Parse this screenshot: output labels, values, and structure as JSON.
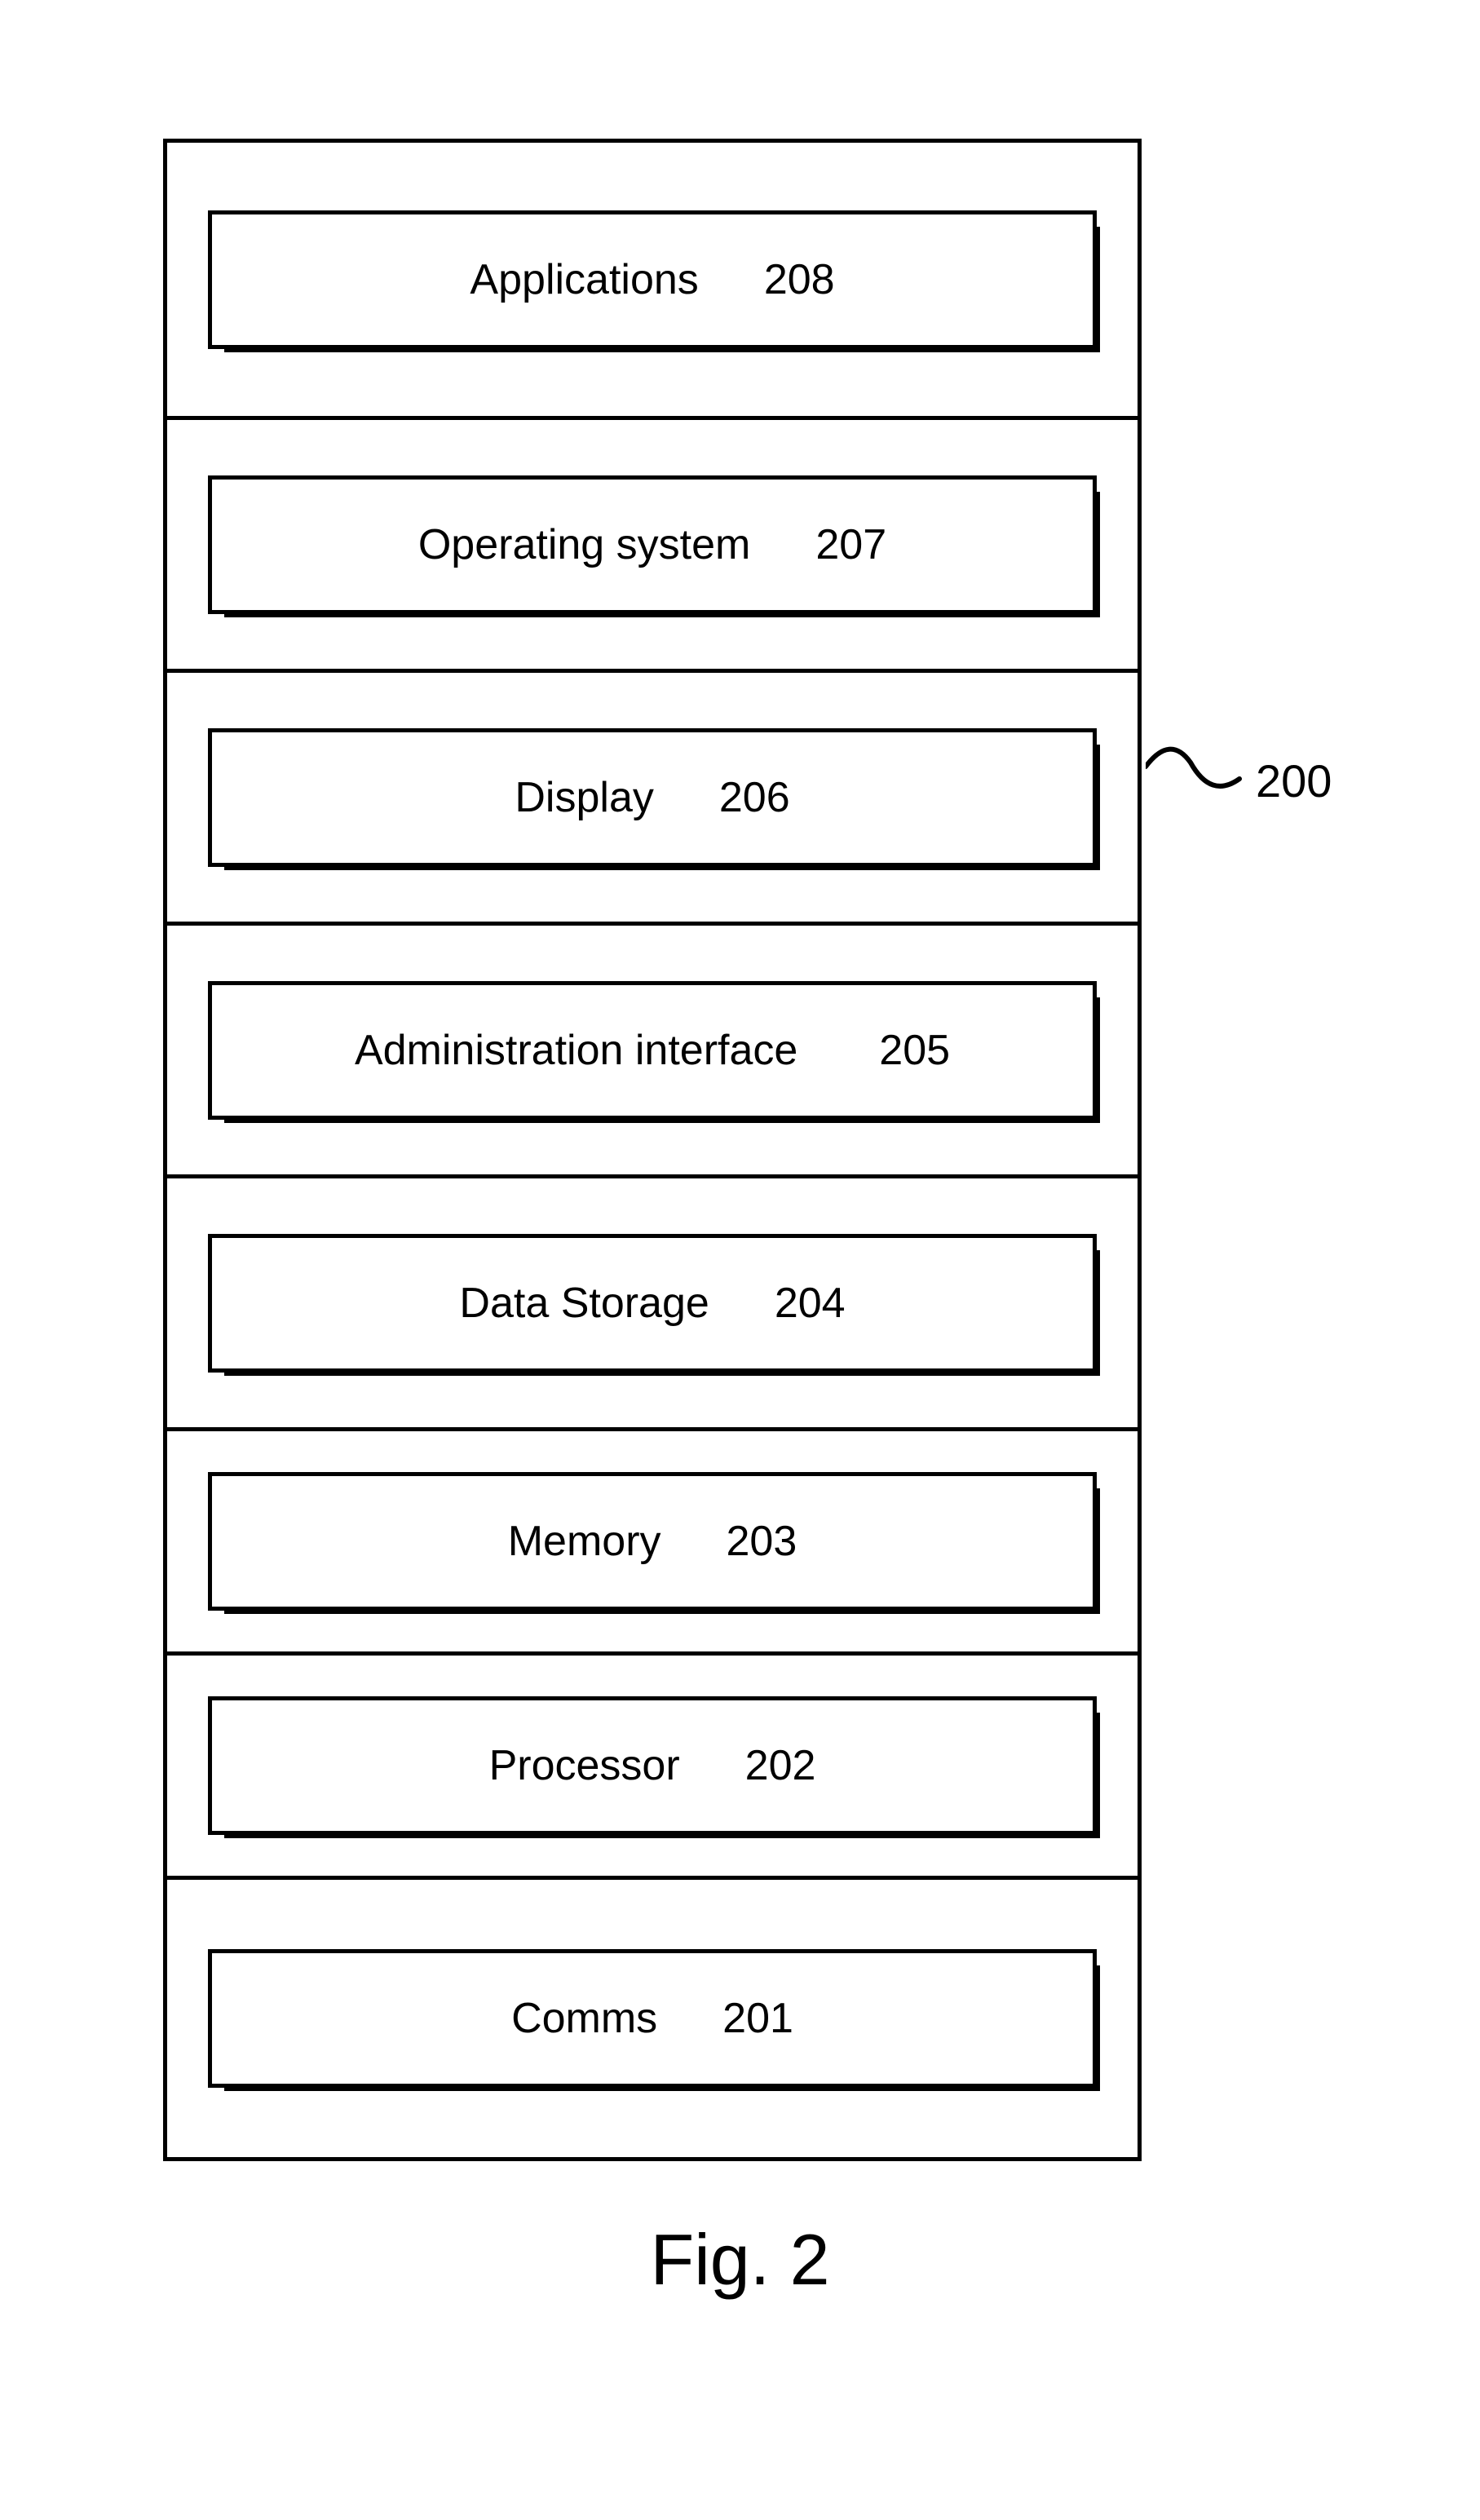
{
  "figure": {
    "caption": "Fig. 2",
    "outer_ref": "200",
    "blocks": [
      {
        "label": "Applications",
        "ref": "208"
      },
      {
        "label": "Operating system",
        "ref": "207"
      },
      {
        "label": "Display",
        "ref": "206"
      },
      {
        "label": "Administration interface",
        "ref": "205"
      },
      {
        "label": "Data Storage",
        "ref": "204"
      },
      {
        "label": "Memory",
        "ref": "203"
      },
      {
        "label": "Processor",
        "ref": "202"
      },
      {
        "label": "Comms",
        "ref": "201"
      }
    ]
  }
}
